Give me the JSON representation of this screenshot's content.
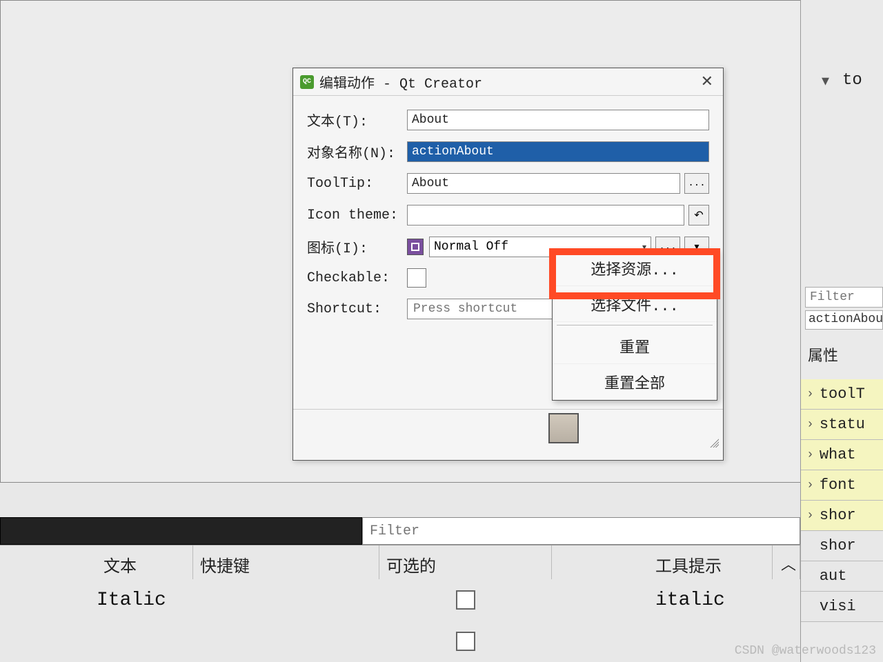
{
  "dialog": {
    "title": "编辑动作 - Qt Creator",
    "logo_text": "QC",
    "labels": {
      "text": "文本(T):",
      "object_name": "对象名称(N):",
      "tooltip": "ToolTip:",
      "icon_theme": "Icon theme:",
      "icon": "图标(I):",
      "checkable": "Checkable:",
      "shortcut": "Shortcut:"
    },
    "values": {
      "text": "About",
      "object_name": "actionAbout",
      "tooltip": "About",
      "icon_theme": "",
      "icon_mode": "Normal Off",
      "shortcut_placeholder": "Press shortcut"
    },
    "ellipsis_btn": "...",
    "reset_icon": "↶"
  },
  "dropdown": {
    "choose_resource": "选择资源...",
    "choose_file": "选择文件...",
    "reset": "重置",
    "reset_all": "重置全部"
  },
  "right_panel": {
    "top_label": "to",
    "filter": "Filter",
    "action_name": "actionAbout",
    "prop_header": "属性",
    "props": [
      "toolT",
      "statu",
      "what",
      "font",
      "shor",
      "shor",
      "aut",
      "visi"
    ]
  },
  "bottom_table": {
    "filter": "Filter",
    "columns": {
      "text": "文本",
      "shortcut": "快捷键",
      "checkable": "可选的",
      "tooltip": "工具提示",
      "scroll": "︿"
    },
    "rows": [
      {
        "text": "Italic",
        "tooltip": "italic"
      }
    ]
  },
  "watermark": "CSDN @waterwoods123"
}
